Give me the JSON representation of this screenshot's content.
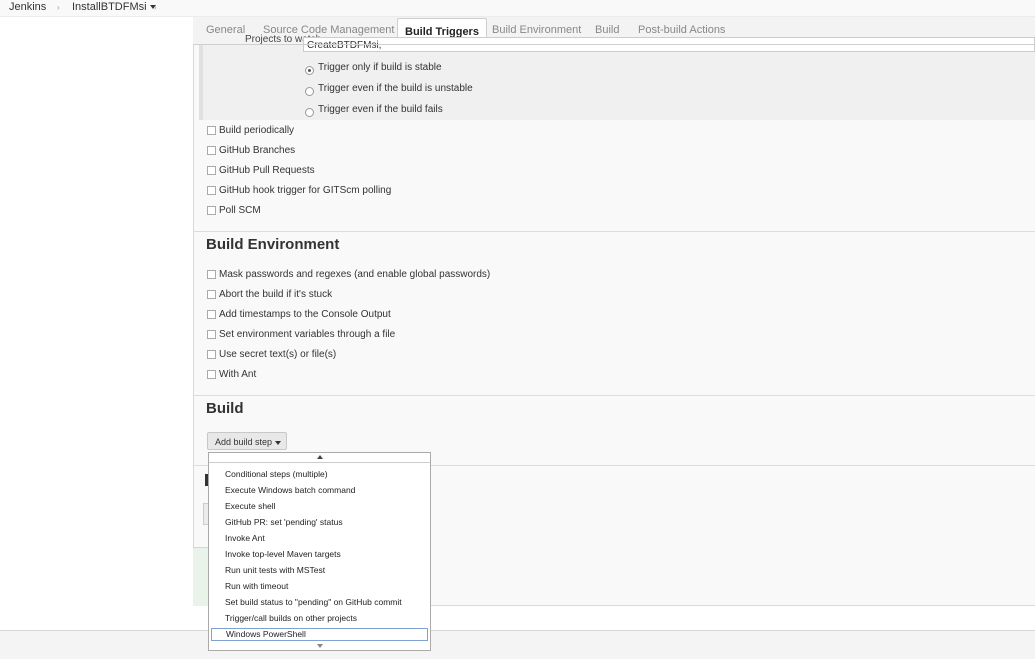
{
  "breadcrumb": {
    "items": [
      "Jenkins",
      "InstallBTDFMsi"
    ]
  },
  "tabs": [
    "General",
    "Source Code Management",
    "Build Triggers",
    "Build Environment",
    "Build",
    "Post-build Actions"
  ],
  "active_tab": "Build Triggers",
  "build_triggers": {
    "projects_to_watch_label": "Projects to watch",
    "projects_to_watch_value": "CreateBTDFMsi,",
    "radio_options": [
      {
        "label": "Trigger only if build is stable",
        "selected": true
      },
      {
        "label": "Trigger even if the build is unstable",
        "selected": false
      },
      {
        "label": "Trigger even if the build fails",
        "selected": false
      }
    ],
    "checkboxes": [
      "Build periodically",
      "GitHub Branches",
      "GitHub Pull Requests",
      "GitHub hook trigger for GITScm polling",
      "Poll SCM"
    ]
  },
  "build_environment": {
    "title": "Build Environment",
    "checkboxes": [
      "Mask passwords and regexes (and enable global passwords)",
      "Abort the build if it's stuck",
      "Add timestamps to the Console Output",
      "Set environment variables through a file",
      "Use secret text(s) or file(s)",
      "With Ant"
    ]
  },
  "build": {
    "title": "Build",
    "add_step_label": "Add build step"
  },
  "dropdown": {
    "items": [
      "Conditional steps (multiple)",
      "Execute Windows batch command",
      "Execute shell",
      "GitHub PR: set 'pending' status",
      "Invoke Ant",
      "Invoke top-level Maven targets",
      "Run unit tests with MSTest",
      "Run with timeout",
      "Set build status to \"pending\" on GitHub commit",
      "Trigger/call builds on other projects",
      "Windows PowerShell"
    ],
    "highlighted": "Windows PowerShell"
  },
  "colors": {
    "highlight_border": "#7ea3d3",
    "panel_background": "#f9f9f9",
    "tab_active_background": "#ffffff"
  }
}
